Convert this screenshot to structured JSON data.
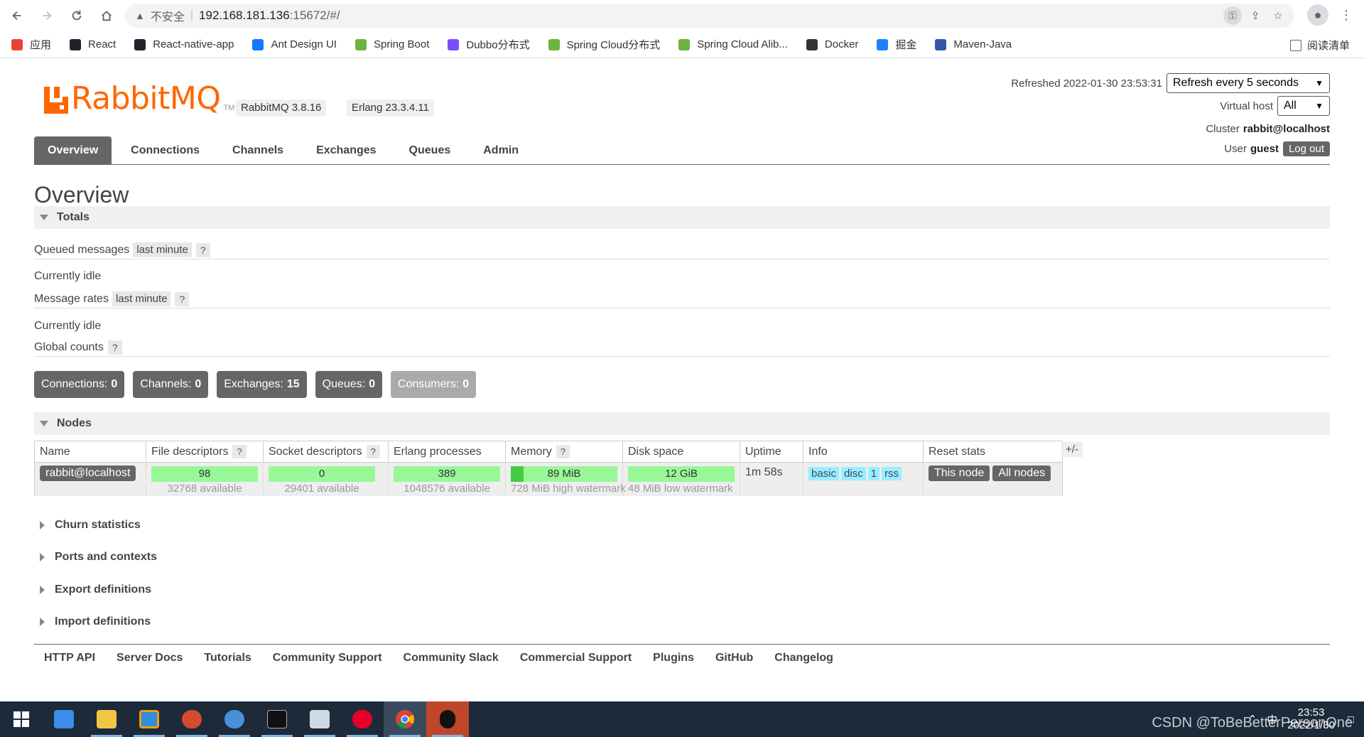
{
  "browser": {
    "insecure_label": "不安全",
    "url_host": "192.168.181.136",
    "url_rest": ":15672/#/",
    "bookmarks": [
      {
        "label": "应用",
        "icon": "apps-grid-icon",
        "color": "#e94235"
      },
      {
        "label": "React",
        "icon": "react-icon",
        "color": "#20232a"
      },
      {
        "label": "React-native-app",
        "icon": "react-icon",
        "color": "#20232a"
      },
      {
        "label": "Ant Design UI",
        "icon": "ant-design-icon",
        "color": "#1677ff"
      },
      {
        "label": "Spring Boot",
        "icon": "spring-icon",
        "color": "#6db33f"
      },
      {
        "label": "Dubbo分布式",
        "icon": "dubbo-icon",
        "color": "#7c4dff"
      },
      {
        "label": "Spring Cloud分布式",
        "icon": "spring-icon",
        "color": "#6db33f"
      },
      {
        "label": "Spring Cloud Alib...",
        "icon": "spring-icon",
        "color": "#6db33f"
      },
      {
        "label": "Docker",
        "icon": "docker-icon",
        "color": "#333333"
      },
      {
        "label": "掘金",
        "icon": "juejin-icon",
        "color": "#1e80ff"
      },
      {
        "label": "Maven-Java",
        "icon": "maven-icon",
        "color": "#3355aa"
      }
    ],
    "reading_list": "阅读清单"
  },
  "header": {
    "logo_text": "RabbitMQ",
    "logo_tm": "TM",
    "rabbitmq_version": "RabbitMQ 3.8.16",
    "erlang_version": "Erlang 23.3.4.11",
    "refreshed_label": "Refreshed 2022-01-30 23:53:31",
    "refresh_select": "Refresh every 5 seconds",
    "vhost_label": "Virtual host",
    "vhost_select": "All",
    "cluster_label": "Cluster",
    "cluster_value": "rabbit@localhost",
    "user_label": "User",
    "user_value": "guest",
    "logout_label": "Log out"
  },
  "tabs": [
    "Overview",
    "Connections",
    "Channels",
    "Exchanges",
    "Queues",
    "Admin"
  ],
  "overview": {
    "title": "Overview",
    "totals_label": "Totals",
    "queued_messages_label": "Queued messages",
    "last_minute": "last minute",
    "help": "?",
    "currently_idle": "Currently idle",
    "message_rates_label": "Message rates",
    "global_counts_label": "Global counts",
    "counts": [
      {
        "label": "Connections:",
        "value": "0",
        "enabled": true
      },
      {
        "label": "Channels:",
        "value": "0",
        "enabled": true
      },
      {
        "label": "Exchanges:",
        "value": "15",
        "enabled": true
      },
      {
        "label": "Queues:",
        "value": "0",
        "enabled": true
      },
      {
        "label": "Consumers:",
        "value": "0",
        "enabled": false
      }
    ]
  },
  "nodes": {
    "section_label": "Nodes",
    "columns": {
      "name": "Name",
      "file_descriptors": "File descriptors",
      "socket_descriptors": "Socket descriptors",
      "erlang_processes": "Erlang processes",
      "memory": "Memory",
      "disk_space": "Disk space",
      "uptime": "Uptime",
      "info": "Info",
      "reset_stats": "Reset stats"
    },
    "row": {
      "name": "rabbit@localhost",
      "file_descriptors": "98",
      "file_descriptors_available": "32768 available",
      "socket_descriptors": "0",
      "socket_descriptors_available": "29401 available",
      "erlang_processes": "389",
      "erlang_processes_available": "1048576 available",
      "memory": "89 MiB",
      "memory_fraction": 0.12,
      "memory_watermark": "728 MiB high watermark",
      "disk_space": "12 GiB",
      "disk_watermark": "48 MiB low watermark",
      "uptime": "1m 58s",
      "info_tags": [
        "basic",
        "disc",
        "1",
        "rss"
      ],
      "reset_this_node": "This node",
      "reset_all_nodes": "All nodes"
    },
    "plus_minus": "+/-"
  },
  "collapsed_sections": [
    "Churn statistics",
    "Ports and contexts",
    "Export definitions",
    "Import definitions"
  ],
  "footer_links": [
    "HTTP API",
    "Server Docs",
    "Tutorials",
    "Community Support",
    "Community Slack",
    "Commercial Support",
    "Plugins",
    "GitHub",
    "Changelog"
  ],
  "taskbar": {
    "time": "23:53",
    "date": "2022/1/30",
    "ime": "中",
    "watermark": "CSDN @ToBeBetterPersonOne"
  }
}
